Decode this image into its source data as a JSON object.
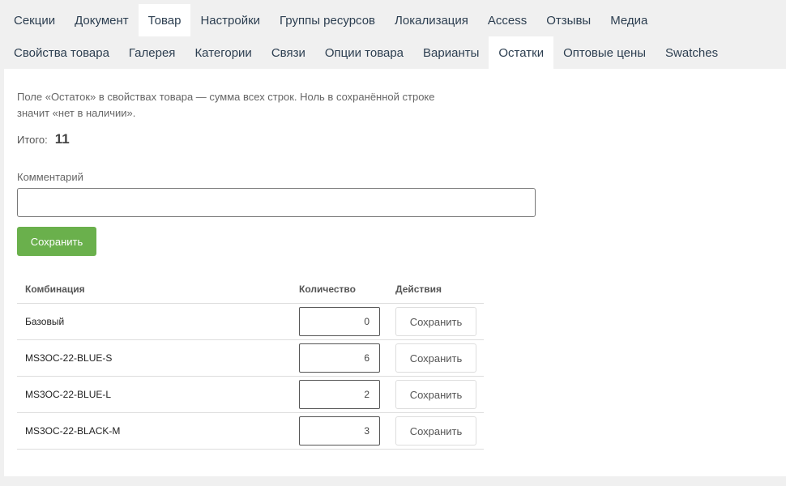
{
  "top_tabs": [
    {
      "label": "Секции",
      "active": false
    },
    {
      "label": "Документ",
      "active": false
    },
    {
      "label": "Товар",
      "active": true
    },
    {
      "label": "Настройки",
      "active": false
    },
    {
      "label": "Группы ресурсов",
      "active": false
    },
    {
      "label": "Локализация",
      "active": false
    },
    {
      "label": "Access",
      "active": false
    },
    {
      "label": "Отзывы",
      "active": false
    },
    {
      "label": "Медиа",
      "active": false
    }
  ],
  "sub_tabs": [
    {
      "label": "Свойства товара",
      "active": false
    },
    {
      "label": "Галерея",
      "active": false
    },
    {
      "label": "Категории",
      "active": false
    },
    {
      "label": "Связи",
      "active": false
    },
    {
      "label": "Опции товара",
      "active": false
    },
    {
      "label": "Варианты",
      "active": false
    },
    {
      "label": "Остатки",
      "active": true
    },
    {
      "label": "Оптовые цены",
      "active": false
    },
    {
      "label": "Swatches",
      "active": false
    }
  ],
  "panel": {
    "description": "Поле «Остаток» в свойствах товара — сумма всех строк. Ноль в сохранённой строке значит «нет в наличии».",
    "total_label": "Итого:",
    "total_value": "11",
    "comment_label": "Комментарий",
    "comment_value": "",
    "save_label": "Сохранить",
    "save_color": "#6ab04c"
  },
  "table": {
    "headers": {
      "combination": "Комбинация",
      "quantity": "Количество",
      "actions": "Действия"
    },
    "rows": [
      {
        "combination": "Базовый",
        "quantity": "0",
        "action": "Сохранить"
      },
      {
        "combination": "MS3OC-22-BLUE-S",
        "quantity": "6",
        "action": "Сохранить"
      },
      {
        "combination": "MS3OC-22-BLUE-L",
        "quantity": "2",
        "action": "Сохранить"
      },
      {
        "combination": "MS3OC-22-BLACK-M",
        "quantity": "3",
        "action": "Сохранить"
      }
    ]
  }
}
